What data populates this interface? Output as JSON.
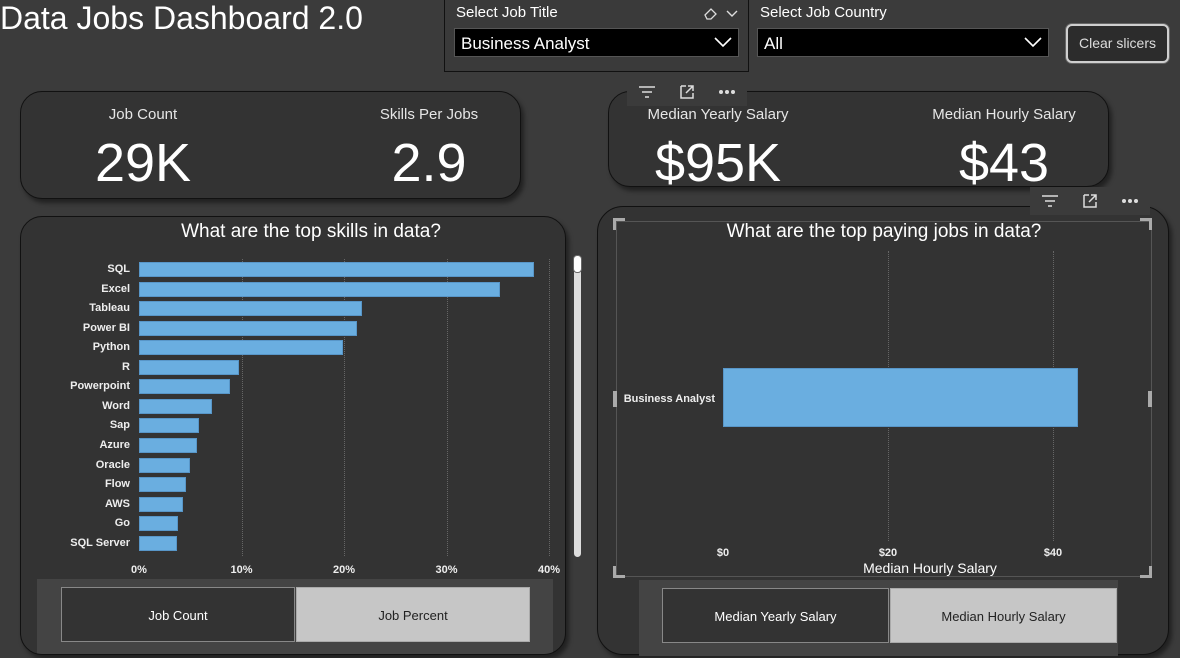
{
  "title": "Data Jobs Dashboard 2.0",
  "slicers": {
    "job_title": {
      "label": "Select Job Title",
      "value": "Business Analyst"
    },
    "job_country": {
      "label": "Select Job Country",
      "value": "All"
    },
    "clear_label": "Clear slicers"
  },
  "kpis": {
    "job_count": {
      "label": "Job Count",
      "value": "29K"
    },
    "skills_per_job": {
      "label": "Skills Per Jobs",
      "value": "2.9"
    },
    "median_yearly": {
      "label": "Median Yearly Salary",
      "value": "$95K"
    },
    "median_hourly": {
      "label": "Median Hourly Salary",
      "value": "$43"
    }
  },
  "skills_chart": {
    "title": "What are the top skills in data?",
    "x_label": "Job Percent",
    "toggle": {
      "left": "Job Count",
      "right": "Job Percent"
    }
  },
  "pay_chart": {
    "title": "What are the top paying jobs in data?",
    "x_label": "Median Hourly Salary",
    "toggle": {
      "left": "Median Yearly Salary",
      "right": "Median Hourly Salary"
    }
  },
  "colors": {
    "bar": "#6aaee0",
    "background": "#3b3b3b",
    "card": "#333333"
  },
  "chart_data": [
    {
      "type": "bar",
      "orientation": "horizontal",
      "title": "What are the top skills in data?",
      "xlabel": "Job Percent",
      "categories": [
        "SQL",
        "Excel",
        "Tableau",
        "Power BI",
        "Python",
        "R",
        "Powerpoint",
        "Word",
        "Sap",
        "Azure",
        "Oracle",
        "Flow",
        "AWS",
        "Go",
        "SQL Server"
      ],
      "values": [
        38.5,
        35.2,
        21.8,
        21.3,
        19.9,
        9.8,
        8.9,
        7.1,
        5.9,
        5.7,
        5.0,
        4.6,
        4.3,
        3.8,
        3.7
      ],
      "xlim": [
        0,
        40
      ],
      "xticks": [
        "0%",
        "10%",
        "20%",
        "30%",
        "40%"
      ],
      "grid": true
    },
    {
      "type": "bar",
      "orientation": "horizontal",
      "title": "What are the top paying jobs in data?",
      "xlabel": "Median Hourly Salary",
      "categories": [
        "Business Analyst"
      ],
      "values": [
        43
      ],
      "xlim": [
        0,
        43
      ],
      "xticks": [
        "$0",
        "$20",
        "$40"
      ],
      "grid": true
    }
  ]
}
